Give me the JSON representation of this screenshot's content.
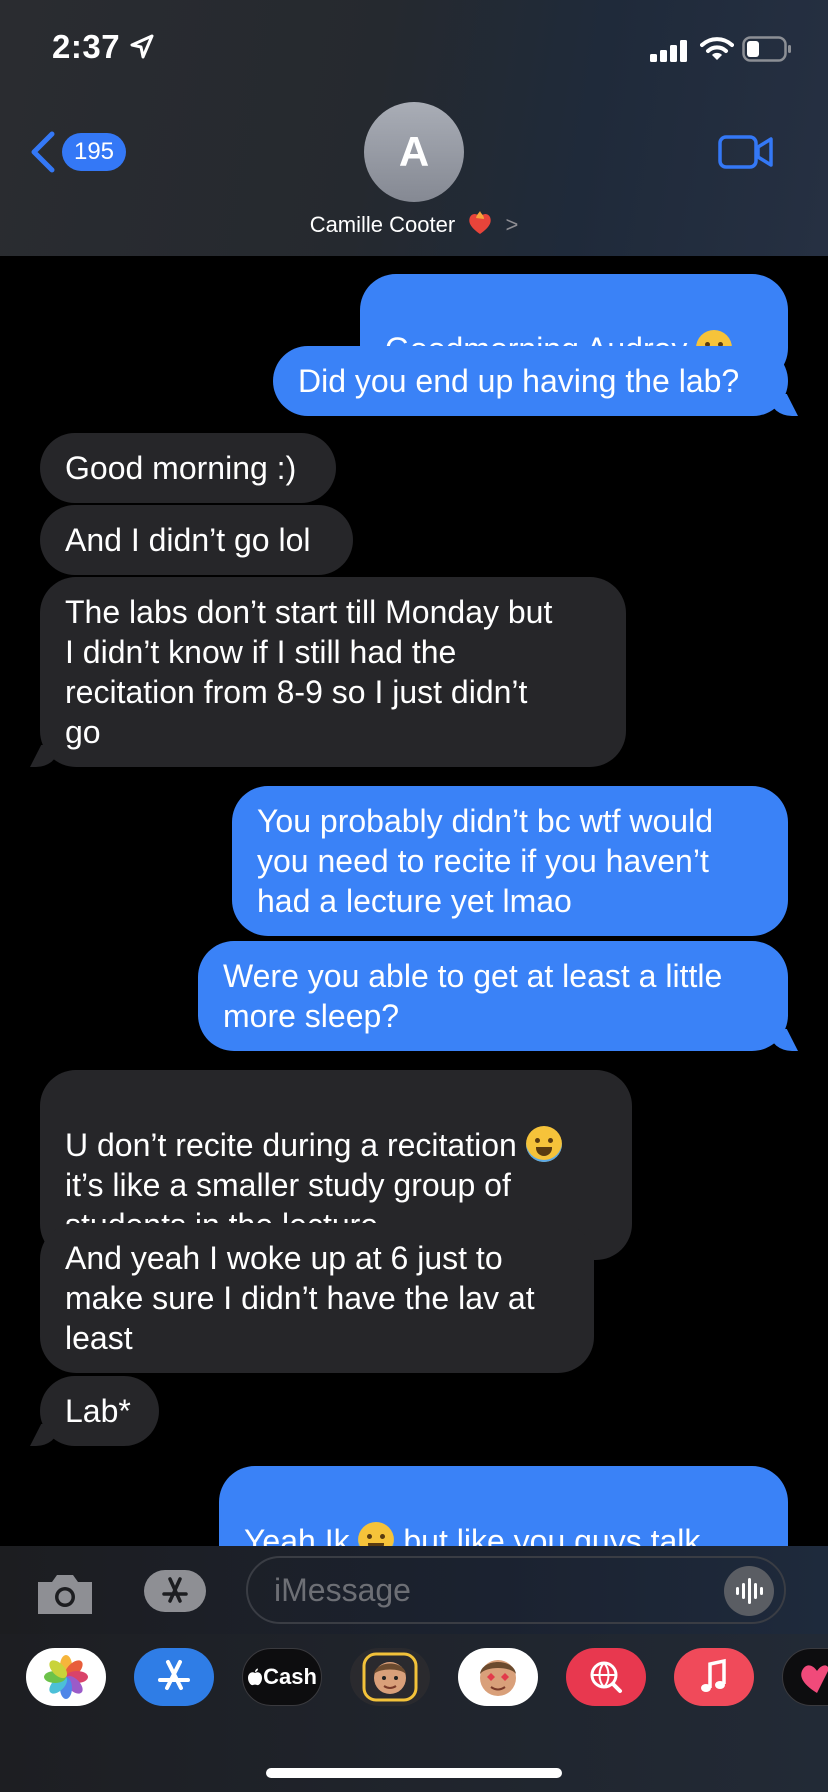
{
  "status_bar": {
    "time": "2:37"
  },
  "header": {
    "back_count": "195",
    "avatar_initial": "A",
    "contact_name": "Camille Cooter",
    "contact_chevron": ">"
  },
  "messages": [
    {
      "from": "me",
      "text": "Goodmorning Audrey ",
      "emoji": "kissing-face"
    },
    {
      "from": "me",
      "text": "Did you end up having the lab?"
    },
    {
      "from": "them",
      "text": "Good morning :)"
    },
    {
      "from": "them",
      "text": "And I didn’t go lol"
    },
    {
      "from": "them",
      "text": "The labs don’t start till Monday but\nI didn’t know if I still had the\nrecitation from 8-9 so I just didn’t\ngo"
    },
    {
      "from": "me",
      "text": "You probably didn’t bc wtf would\nyou need to recite if you haven’t\nhad a lecture yet lmao"
    },
    {
      "from": "me",
      "text": "Were you able to get at least a little\nmore sleep?"
    },
    {
      "from": "them",
      "text": "U don’t recite during a recitation ",
      "text_b": "\nit’s like a smaller study group of\nstudents in the lecture",
      "emoji": "crying-face"
    },
    {
      "from": "them",
      "text": "And yeah I woke up at 6 just to\nmake sure I didn’t have the lav at\nleast"
    },
    {
      "from": "them",
      "text": "Lab*"
    },
    {
      "from": "me",
      "text": "Yeah Ik ",
      "text_b": " but like you guys talk\n(recite) about what you learned in",
      "emoji": "crying-face"
    }
  ],
  "input": {
    "placeholder": "iMessage"
  },
  "app_drawer": [
    {
      "name": "photos"
    },
    {
      "name": "app-store"
    },
    {
      "name": "apple-cash",
      "label": "Cash"
    },
    {
      "name": "memoji-stickers"
    },
    {
      "name": "animoji"
    },
    {
      "name": "images-search"
    },
    {
      "name": "music"
    },
    {
      "name": "digital-touch"
    }
  ],
  "colors": {
    "sent_bubble": "#3a82f7",
    "received_bubble": "#262629",
    "accent": "#3478f6",
    "background": "#000000"
  }
}
